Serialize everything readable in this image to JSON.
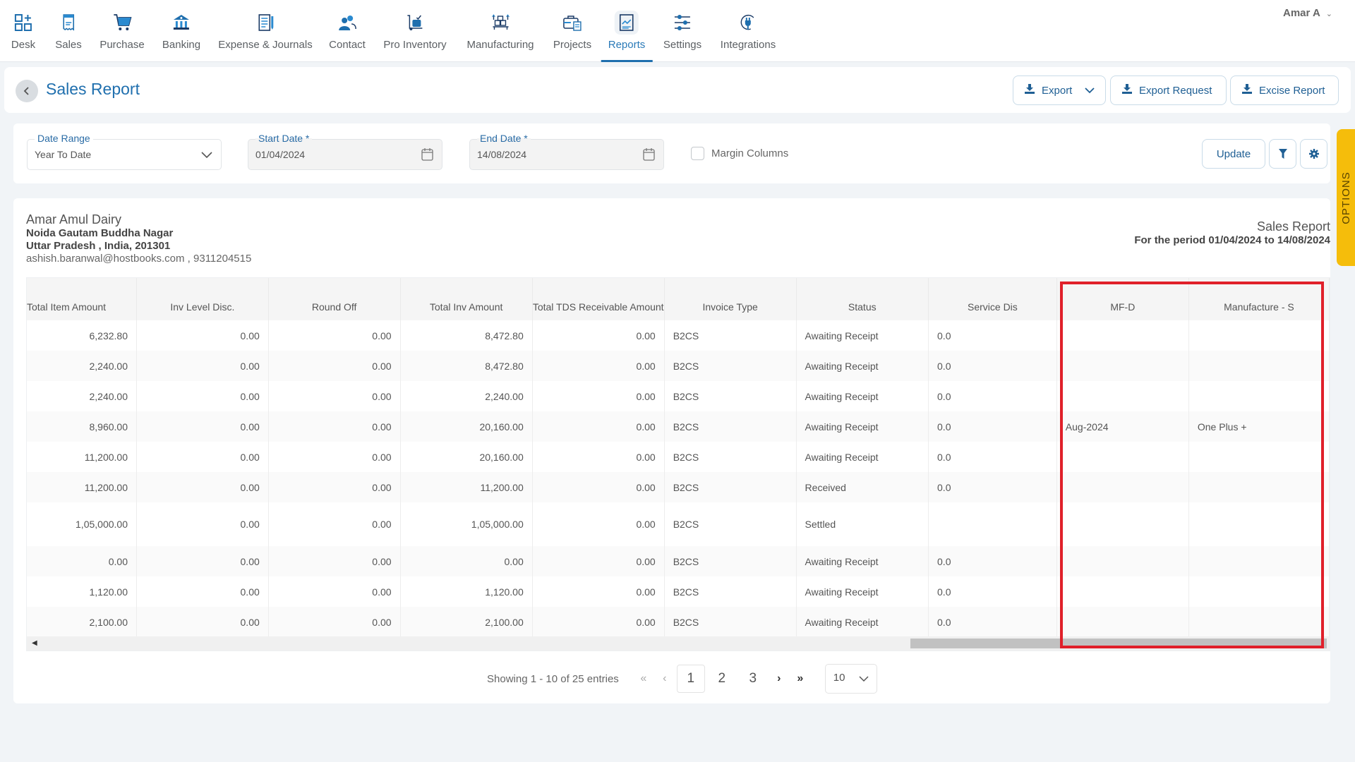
{
  "nav": {
    "items": [
      {
        "label": "Desk",
        "icon": "desk-icon"
      },
      {
        "label": "Sales",
        "icon": "sales-icon"
      },
      {
        "label": "Purchase",
        "icon": "cart-icon"
      },
      {
        "label": "Banking",
        "icon": "bank-icon"
      },
      {
        "label": "Expense & Journals",
        "icon": "journal-icon"
      },
      {
        "label": "Contact",
        "icon": "contacts-icon"
      },
      {
        "label": "Pro Inventory",
        "icon": "inventory-icon"
      },
      {
        "label": "Manufacturing",
        "icon": "manufacturing-icon"
      },
      {
        "label": "Projects",
        "icon": "briefcase-icon"
      },
      {
        "label": "Reports",
        "icon": "report-chart-icon",
        "active": true
      },
      {
        "label": "Settings",
        "icon": "sliders-icon"
      },
      {
        "label": "Integrations",
        "icon": "plug-icon"
      }
    ],
    "notification_count": "0",
    "user_name": "Amar A",
    "accent_color": "#1f6fae"
  },
  "titlebar": {
    "title": "Sales Report",
    "export_label": "Export",
    "export_request_label": "Export Request",
    "excise_report_label": "Excise Report"
  },
  "filters": {
    "date_range_label": "Date Range",
    "date_range_value": "Year To Date",
    "start_date_label": "Start Date *",
    "start_date_value": "01/04/2024",
    "end_date_label": "End Date *",
    "end_date_value": "14/08/2024",
    "margin_columns_label": "Margin Columns",
    "margin_columns_checked": false,
    "update_label": "Update",
    "options_tab_label": "OPTIONS"
  },
  "report": {
    "company_name": "Amar Amul Dairy",
    "address_line1": "Noida Gautam Buddha Nagar",
    "address_line2": "Uttar Pradesh , India, 201301",
    "contact": "ashish.baranwal@hostbooks.com , 9311204515",
    "report_title": "Sales Report",
    "period": "For the period 01/04/2024 to 14/08/2024"
  },
  "table": {
    "columns": [
      "Total Item Amount",
      "Inv Level Disc.",
      "Round Off",
      "Total Inv Amount",
      "Total TDS Receivable Amount",
      "Invoice Type",
      "Status",
      "Service Dis",
      "MF-D",
      "Manufacture - S"
    ],
    "rows": [
      [
        "6,232.80",
        "0.00",
        "0.00",
        "8,472.80",
        "0.00",
        "B2CS",
        "Awaiting Receipt",
        "0.0",
        "",
        ""
      ],
      [
        "2,240.00",
        "0.00",
        "0.00",
        "8,472.80",
        "0.00",
        "B2CS",
        "Awaiting Receipt",
        "0.0",
        "",
        ""
      ],
      [
        "2,240.00",
        "0.00",
        "0.00",
        "2,240.00",
        "0.00",
        "B2CS",
        "Awaiting Receipt",
        "0.0",
        "",
        ""
      ],
      [
        "8,960.00",
        "0.00",
        "0.00",
        "20,160.00",
        "0.00",
        "B2CS",
        "Awaiting Receipt",
        "0.0",
        "Aug-2024",
        "One Plus +"
      ],
      [
        "11,200.00",
        "0.00",
        "0.00",
        "20,160.00",
        "0.00",
        "B2CS",
        "Awaiting Receipt",
        "0.0",
        "",
        ""
      ],
      [
        "11,200.00",
        "0.00",
        "0.00",
        "11,200.00",
        "0.00",
        "B2CS",
        "Received",
        "0.0",
        "",
        ""
      ],
      [
        "1,05,000.00",
        "0.00",
        "0.00",
        "1,05,000.00",
        "0.00",
        "B2CS",
        "Settled",
        "",
        "",
        ""
      ],
      [
        "0.00",
        "0.00",
        "0.00",
        "0.00",
        "0.00",
        "B2CS",
        "Awaiting Receipt",
        "0.0",
        "",
        ""
      ],
      [
        "1,120.00",
        "0.00",
        "0.00",
        "1,120.00",
        "0.00",
        "B2CS",
        "Awaiting Receipt",
        "0.0",
        "",
        ""
      ],
      [
        "2,100.00",
        "0.00",
        "0.00",
        "2,100.00",
        "0.00",
        "B2CS",
        "Awaiting Receipt",
        "0.0",
        "",
        ""
      ]
    ],
    "highlighted_columns": [
      "MF-D",
      "Manufacture - S"
    ],
    "highlight_color": "#e0202a"
  },
  "pagination": {
    "info": "Showing 1 - 10 of 25 entries",
    "pages": [
      "1",
      "2",
      "3"
    ],
    "current_page": "1",
    "per_page": "10"
  }
}
